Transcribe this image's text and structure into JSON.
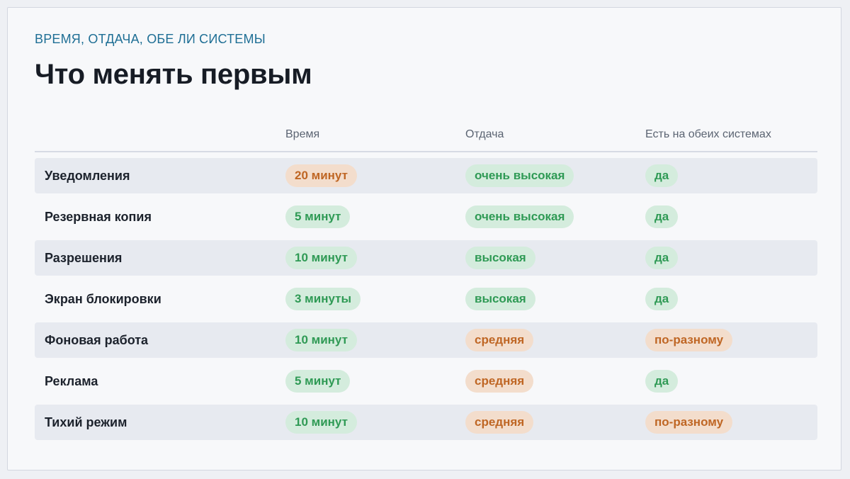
{
  "header": {
    "eyebrow": "ВРЕМЯ, ОТДАЧА, ОБЕ ЛИ СИСТЕМЫ",
    "title": "Что менять первым"
  },
  "table": {
    "columns": [
      "",
      "Время",
      "Отдача",
      "Есть на обеих системах"
    ],
    "rows": [
      {
        "name": "Уведомления",
        "time": "20 минут",
        "time_tone": "orange",
        "return": "очень высокая",
        "return_tone": "green",
        "both": "да",
        "both_tone": "green"
      },
      {
        "name": "Резервная копия",
        "time": "5 минут",
        "time_tone": "green",
        "return": "очень высокая",
        "return_tone": "green",
        "both": "да",
        "both_tone": "green"
      },
      {
        "name": "Разрешения",
        "time": "10 минут",
        "time_tone": "green",
        "return": "высокая",
        "return_tone": "green",
        "both": "да",
        "both_tone": "green"
      },
      {
        "name": "Экран блокировки",
        "time": "3 минуты",
        "time_tone": "green",
        "return": "высокая",
        "return_tone": "green",
        "both": "да",
        "both_tone": "green"
      },
      {
        "name": "Фоновая работа",
        "time": "10 минут",
        "time_tone": "green",
        "return": "средняя",
        "return_tone": "orange",
        "both": "по-разному",
        "both_tone": "orange"
      },
      {
        "name": "Реклама",
        "time": "5 минут",
        "time_tone": "green",
        "return": "средняя",
        "return_tone": "orange",
        "both": "да",
        "both_tone": "green"
      },
      {
        "name": "Тихий режим",
        "time": "10 минут",
        "time_tone": "green",
        "return": "средняя",
        "return_tone": "orange",
        "both": "по-разному",
        "both_tone": "orange"
      }
    ]
  },
  "colors": {
    "accent": "#1f6f95",
    "green_bg": "#d4ecdd",
    "green_text": "#2f9a55",
    "orange_bg": "#f3ddcc",
    "orange_text": "#bf6624"
  }
}
